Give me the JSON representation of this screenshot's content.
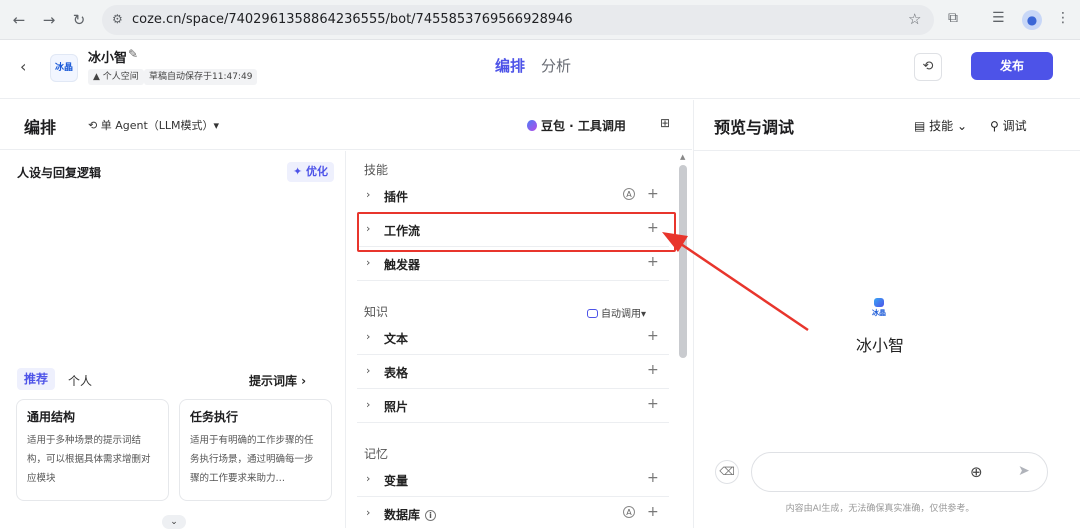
{
  "browser": {
    "url": "coze.cn/space/7402961358864236555/bot/7455853769566928946",
    "back_icon": "←",
    "forward_icon": "→",
    "reload_icon": "↻"
  },
  "header": {
    "back_icon": "‹",
    "bot_logo_text": "冰晶",
    "bot_name": "冰小智",
    "edit_icon": "✎",
    "space_chip": "个人空间",
    "autosave_chip": "草稿自动保存于11:47:49",
    "tab_arrange": "编排",
    "tab_analysis": "分析",
    "history_icon": "⟲",
    "publish_label": "发布"
  },
  "toolbar": {
    "title": "编排",
    "mode_label": "单 Agent（LLM模式）▾",
    "model_label": "豆包 · 工具调用",
    "grid_icon": "⊞"
  },
  "persona": {
    "title": "人设与回复逻辑",
    "optimize_label": "✦ 优化",
    "tabs": [
      "推荐",
      "个人"
    ],
    "prompt_library": "提示词库 ›",
    "cards": [
      {
        "title": "通用结构",
        "desc": "适用于多种场景的提示词结构，可以根据具体需求增删对应模块"
      },
      {
        "title": "任务执行",
        "desc": "适用于有明确的工作步骤的任务执行场景，通过明确每一步骤的工作要求来助力…"
      }
    ],
    "expand_icon": "⌄"
  },
  "skills": {
    "section_skills": "技能",
    "plugin": "插件",
    "workflow": "工作流",
    "trigger": "触发器",
    "section_knowledge": "知识",
    "auto_call": "自动调用▾",
    "text": "文本",
    "table": "表格",
    "photo": "照片",
    "section_memory": "记忆",
    "variable": "变量",
    "database": "数据库",
    "auto_icon": "A",
    "info_icon": "i",
    "plus": "+",
    "chevron": "›"
  },
  "preview": {
    "title": "预览与调试",
    "skill_label": "技能 ⌄",
    "debug_label": "调试",
    "logo_text": "冰晶",
    "bot_name": "冰小智",
    "input_value": "",
    "add_icon": "⊕",
    "send_icon": "➤",
    "clear_icon": "⌫",
    "disclaimer": "内容由AI生成，无法确保真实准确，仅供参考。"
  },
  "colors": {
    "accent": "#4d53e8",
    "highlight": "#e8352c"
  }
}
